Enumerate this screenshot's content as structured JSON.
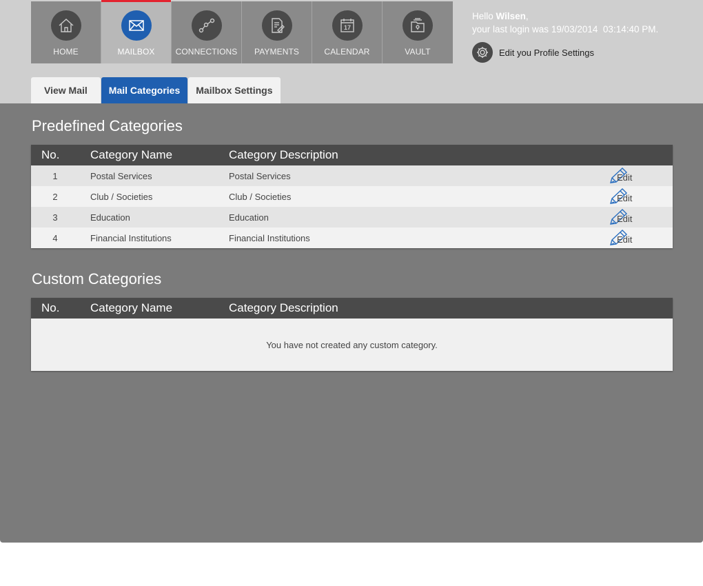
{
  "nav": {
    "items": [
      {
        "label": "HOME",
        "icon": "home-icon"
      },
      {
        "label": "MAILBOX",
        "icon": "mail-icon",
        "active": true
      },
      {
        "label": "CONNECTIONS",
        "icon": "connections-icon"
      },
      {
        "label": "PAYMENTS",
        "icon": "payments-icon"
      },
      {
        "label": "CALENDAR",
        "icon": "calendar-icon",
        "day": "17"
      },
      {
        "label": "VAULT",
        "icon": "vault-icon"
      }
    ]
  },
  "user": {
    "greeting": "Hello",
    "name": "Wilsen",
    "last_login_label": "your last login was",
    "last_login_date": "19/03/2014",
    "last_login_time": "03:14:40 PM.",
    "profile_link": "Edit you Profile Settings"
  },
  "tabs": [
    {
      "label": "View Mail"
    },
    {
      "label": "Mail Categories",
      "active": true
    },
    {
      "label": "Mailbox Settings"
    }
  ],
  "predefined": {
    "title": "Predefined Categories",
    "headers": {
      "no": "No.",
      "name": "Category Name",
      "desc": "Category Description"
    },
    "rows": [
      {
        "no": "1",
        "name": "Postal Services",
        "desc": "Postal Services",
        "edit": "Edit"
      },
      {
        "no": "2",
        "name": "Club / Societies",
        "desc": "Club / Societies",
        "edit": "Edit"
      },
      {
        "no": "3",
        "name": "Education",
        "desc": "Education",
        "edit": "Edit"
      },
      {
        "no": "4",
        "name": "Financial Institutions",
        "desc": "Financial Institutions",
        "edit": "Edit"
      }
    ]
  },
  "custom": {
    "title": "Custom Categories",
    "headers": {
      "no": "No.",
      "name": "Category Name",
      "desc": "Category Description"
    },
    "empty_message": "You have not created any custom category."
  },
  "colors": {
    "accent": "#1f5fb0",
    "active_indicator": "#e3232f",
    "content_bg": "#7b7b7b",
    "header_bg": "#cfcfcf",
    "table_header": "#4a4a4a"
  }
}
